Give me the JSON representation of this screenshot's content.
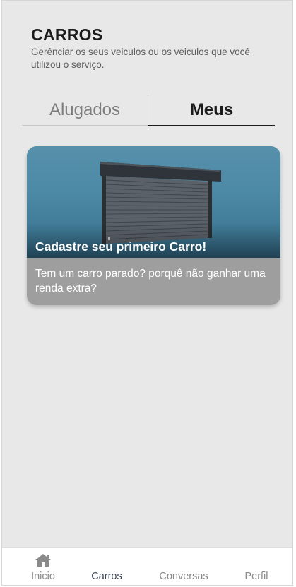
{
  "header": {
    "title": "CARROS",
    "subtitle": "Gerênciar os seus veiculos ou os veiculos que você utilizou o serviço."
  },
  "tabs": [
    {
      "label": "Alugados",
      "active": false
    },
    {
      "label": "Meus",
      "active": true
    }
  ],
  "card": {
    "title": "Cadastre seu primeiro Carro!",
    "body": "Tem um carro parado? porquê não ganhar uma renda extra?",
    "image": "roller-shutter-door"
  },
  "nav": {
    "items": [
      {
        "label": "Inicio",
        "icon": "home-icon"
      },
      {
        "label": "Carros"
      },
      {
        "label": "Conversas"
      },
      {
        "label": "Perfil"
      }
    ],
    "active_index": 1
  },
  "colors": {
    "background": "#e8e8e8",
    "card_image_blue": "#4d8aa6",
    "card_footer": "#9e9e9e",
    "active_nav": "#3a4556"
  }
}
